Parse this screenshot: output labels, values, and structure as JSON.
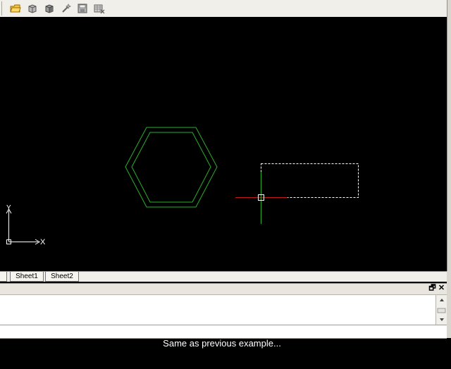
{
  "toolbar": {
    "icons": [
      "open-folder-icon",
      "cube-icon",
      "cube-shaded-icon",
      "wand-icon",
      "save-icon",
      "database-delete-icon"
    ]
  },
  "canvas": {
    "background": "#000000",
    "shape_color": "#2aaf2a",
    "crosshair_h_color": "#c01818",
    "crosshair_v_color": "#2aaf2a",
    "ucs": {
      "x_label": "X",
      "y_label": "Y"
    }
  },
  "tabs": {
    "items": [
      {
        "label": "Sheet1"
      },
      {
        "label": "Sheet2"
      }
    ]
  },
  "command_window": {
    "restore_glyph": "🗗",
    "close_glyph": "✕"
  },
  "caption": "Same as previous example..."
}
